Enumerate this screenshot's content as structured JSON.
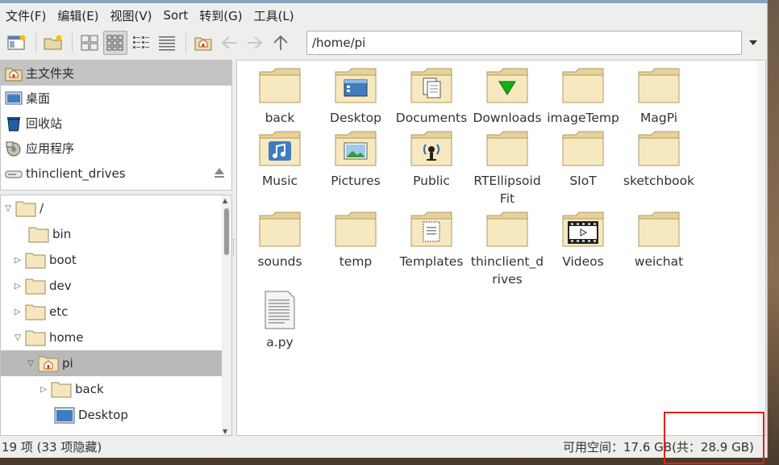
{
  "menubar": {
    "items": [
      "文件(F)",
      "编辑(E)",
      "视图(V)",
      "Sort",
      "转到(G)",
      "工具(L)"
    ]
  },
  "toolbar": {
    "path": "/home/pi"
  },
  "places": [
    {
      "label": "主文件夹",
      "icon": "home-icon",
      "selected": true
    },
    {
      "label": "桌面",
      "icon": "desktop-icon"
    },
    {
      "label": "回收站",
      "icon": "trash-icon"
    },
    {
      "label": "应用程序",
      "icon": "applications-icon"
    },
    {
      "label": "thinclient_drives",
      "icon": "drive-icon",
      "eject": true
    }
  ],
  "tree": [
    {
      "label": "/",
      "level": 0,
      "expander": "down"
    },
    {
      "label": "bin",
      "level": 1,
      "expander": ""
    },
    {
      "label": "boot",
      "level": 1,
      "expander": "right"
    },
    {
      "label": "dev",
      "level": 1,
      "expander": "right"
    },
    {
      "label": "etc",
      "level": 1,
      "expander": "right"
    },
    {
      "label": "home",
      "level": 1,
      "expander": "down"
    },
    {
      "label": "pi",
      "level": 2,
      "expander": "down",
      "selected": true,
      "icon": "home"
    },
    {
      "label": "back",
      "level": 3,
      "expander": "right"
    },
    {
      "label": "Desktop",
      "level": 3,
      "expander": "",
      "icon": "desktop"
    }
  ],
  "files": [
    {
      "label": "back",
      "icon": "folder"
    },
    {
      "label": "Desktop",
      "icon": "folder-desktop"
    },
    {
      "label": "Documents",
      "icon": "folder-documents"
    },
    {
      "label": "Downloads",
      "icon": "folder-downloads"
    },
    {
      "label": "imageTemp",
      "icon": "folder"
    },
    {
      "label": "MagPi",
      "icon": "folder"
    },
    {
      "label": "Music",
      "icon": "folder-music"
    },
    {
      "label": "Pictures",
      "icon": "folder-pictures"
    },
    {
      "label": "Public",
      "icon": "folder-public"
    },
    {
      "label": "RTEllipsoidFit",
      "icon": "folder"
    },
    {
      "label": "SIoT",
      "icon": "folder"
    },
    {
      "label": "sketchbook",
      "icon": "folder"
    },
    {
      "label": "sounds",
      "icon": "folder"
    },
    {
      "label": "temp",
      "icon": "folder"
    },
    {
      "label": "Templates",
      "icon": "folder-templates"
    },
    {
      "label": "thinclient_drives",
      "icon": "folder"
    },
    {
      "label": "Videos",
      "icon": "folder-videos"
    },
    {
      "label": "weichat",
      "icon": "folder"
    },
    {
      "label": "a.py",
      "icon": "text-file"
    }
  ],
  "status": {
    "left": "19 项 (33 项隐藏)",
    "right": "可用空间：17.6 GB(共：28.9 GB)"
  }
}
